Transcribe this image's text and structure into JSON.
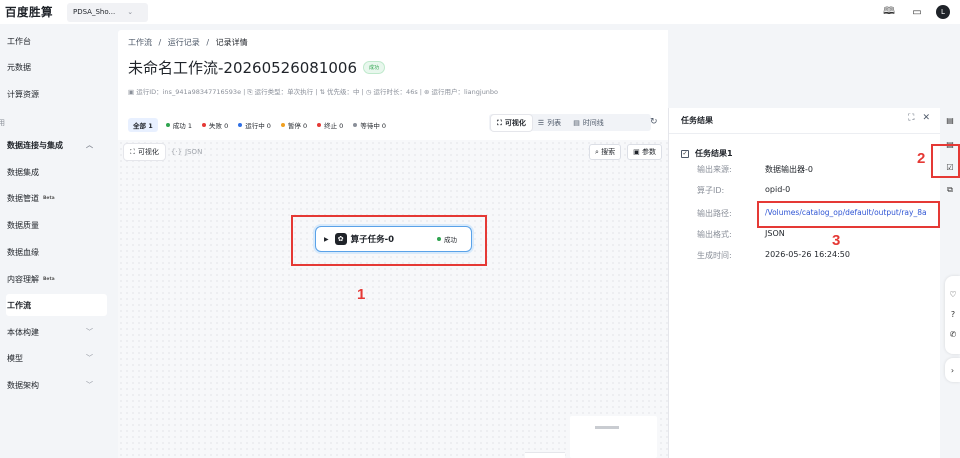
{
  "app": {
    "logo": "百度胜算",
    "workspace": "PDSA_Sho...",
    "avatar": "L"
  },
  "sidebar": {
    "cut_label": "用",
    "items": [
      {
        "label": "工作台"
      },
      {
        "label": "元数据"
      },
      {
        "label": "计算资源"
      },
      {
        "label": "数据连接与集成"
      },
      {
        "label": "数据集成"
      },
      {
        "label": "数据管道",
        "beta": "Beta"
      },
      {
        "label": "数据质量"
      },
      {
        "label": "数据血缘"
      },
      {
        "label": "内容理解",
        "beta": "Beta"
      },
      {
        "label": "工作流"
      },
      {
        "label": "本体构建"
      },
      {
        "label": "模型"
      },
      {
        "label": "数据架构"
      }
    ]
  },
  "breadcrumb": {
    "a": "工作流",
    "sep": "/",
    "b": "运行记录",
    "c": "记录详情"
  },
  "title": "未命名工作流-20260526081006",
  "title_status": "成功",
  "meta": "▣ 运行ID：ins_941a98347716593e  |  ⎘ 运行类型：单次执行  |  ⇅ 优先级：中  |  ◷ 运行时长：46s  |  ⊛ 运行用户：liangjunbo",
  "filters": {
    "all": "全部 1",
    "items": [
      {
        "label": "成功 1",
        "color": "#2fa44f"
      },
      {
        "label": "失败 0",
        "color": "#e53935"
      },
      {
        "label": "运行中 0",
        "color": "#2f6fe4"
      },
      {
        "label": "暂停 0",
        "color": "#f0a020"
      },
      {
        "label": "终止 0",
        "color": "#e53935"
      },
      {
        "label": "等待中 0",
        "color": "#8a8f99"
      }
    ]
  },
  "views": {
    "visual": "可视化",
    "list": "列表",
    "timeline": "时间线"
  },
  "canvas": {
    "tab_visual": "可视化",
    "tab_json": "JSON",
    "search": "搜索",
    "params": "参数",
    "node_label": "算子任务-0",
    "node_status": "成功"
  },
  "panel": {
    "title": "任务结果",
    "result_title": "任务结果1",
    "rows": [
      {
        "k": "输出来源:",
        "v": "数据输出器-0"
      },
      {
        "k": "算子ID:",
        "v": "opid-0"
      },
      {
        "k": "输出路径:",
        "v": "/Volumes/catalog_op/default/output/ray_8a"
      },
      {
        "k": "输出格式:",
        "v": "JSON"
      },
      {
        "k": "生成时间:",
        "v": "2026-05-26 16:24:50"
      }
    ]
  },
  "annotations": {
    "n1": "1",
    "n2": "2",
    "n3": "3"
  },
  "colors": {
    "highlight": "#e53935",
    "link": "#2f55d4",
    "success": "#2fa44f"
  }
}
